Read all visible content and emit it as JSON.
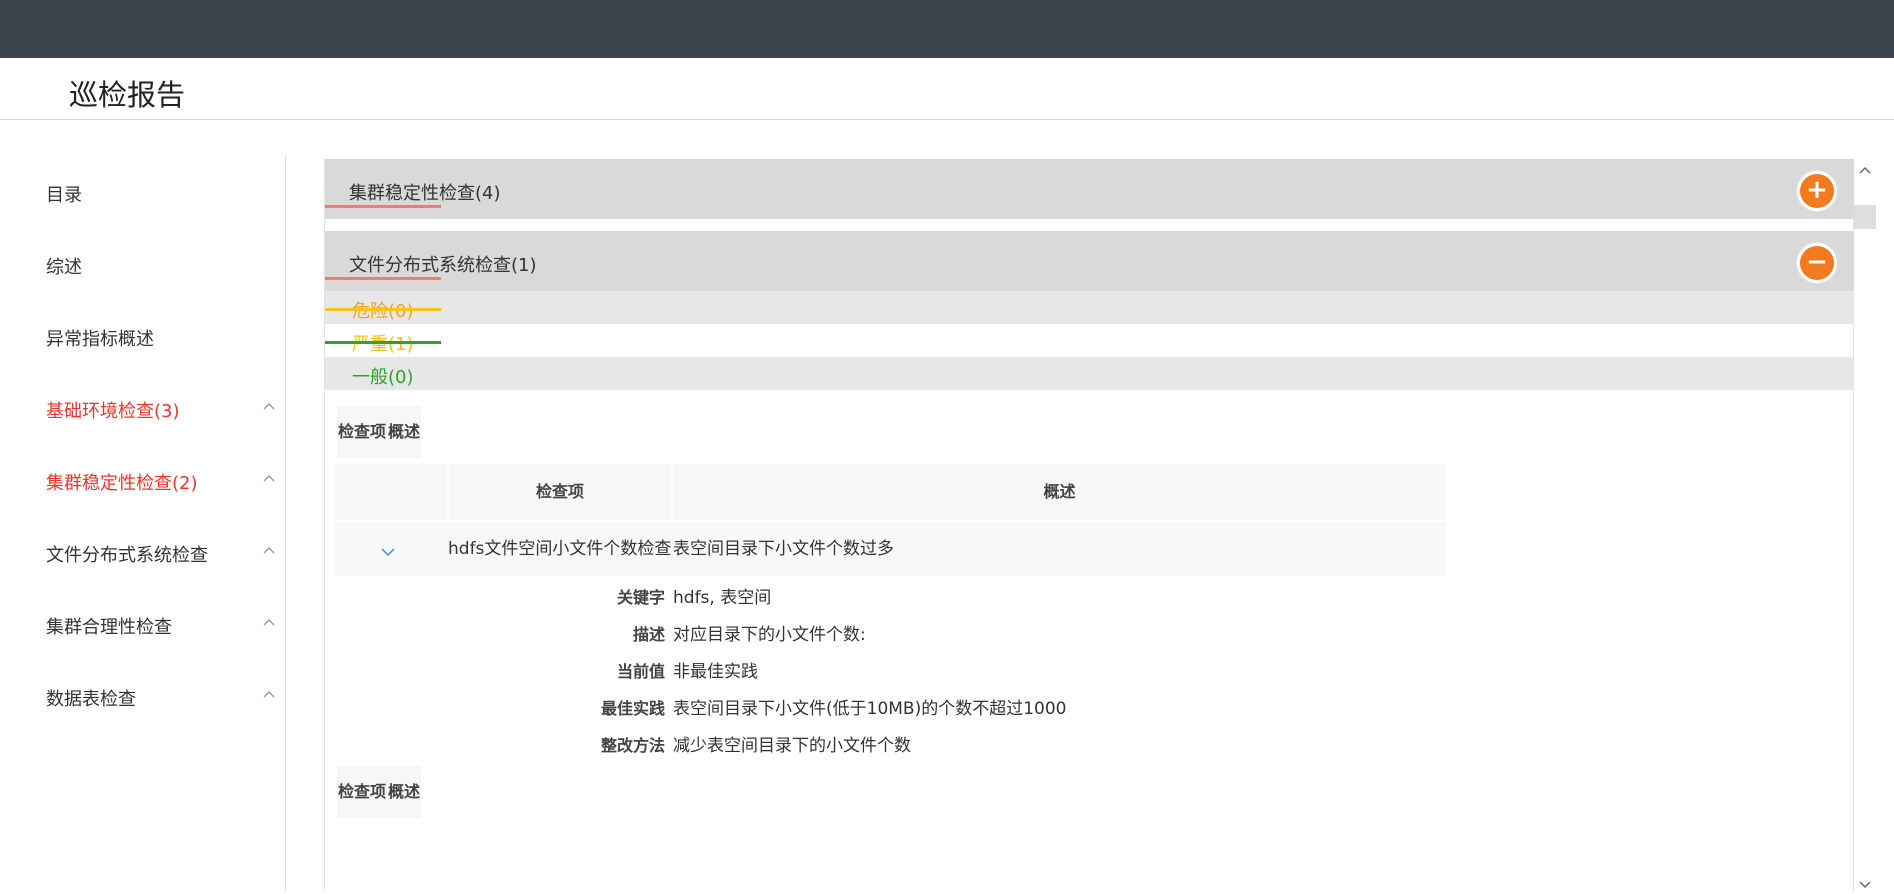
{
  "header": {
    "title": "巡检报告"
  },
  "sidebar": {
    "items": [
      {
        "label": "目录",
        "highlight": false,
        "has_chevron": false
      },
      {
        "label": "综述",
        "highlight": false,
        "has_chevron": false
      },
      {
        "label": "异常指标概述",
        "highlight": false,
        "has_chevron": false
      },
      {
        "label": "基础环境检查(3)",
        "highlight": true,
        "has_chevron": true
      },
      {
        "label": "集群稳定性检查(2)",
        "highlight": true,
        "has_chevron": true
      },
      {
        "label": "文件分布式系统检查",
        "highlight": false,
        "has_chevron": true
      },
      {
        "label": "集群合理性检查",
        "highlight": false,
        "has_chevron": true
      },
      {
        "label": "数据表检查",
        "highlight": false,
        "has_chevron": true
      }
    ]
  },
  "panels": [
    {
      "title": "集群稳定性检查(4)",
      "state": "collapsed",
      "toggle_icon": "plus-icon",
      "toggle_glyph": "+"
    },
    {
      "title": "文件分布式系统检查(1)",
      "state": "expanded",
      "toggle_icon": "minus-icon",
      "toggle_glyph": "−"
    }
  ],
  "severity": [
    {
      "label": "危险(0)",
      "color": "#f4a22a",
      "line_color": "#f5c518"
    },
    {
      "label": "严重(1)",
      "color": "#f2c11a",
      "line_color": "#2aa52a"
    },
    {
      "label": "一般(0)",
      "color": "#2aa52a",
      "line_color": ""
    }
  ],
  "tabs": {
    "item": "检查项",
    "summary": "概述"
  },
  "table": {
    "columns": [
      "",
      "检查项",
      "概述"
    ],
    "rows": [
      {
        "item": "hdfs文件空间小文件个数检查",
        "summary": "表空间目录下小文件个数过多"
      }
    ]
  },
  "detail": [
    {
      "label": "关键字",
      "value": "hdfs, 表空间"
    },
    {
      "label": "描述",
      "value": "对应目录下的小文件个数:"
    },
    {
      "label": "当前值",
      "value": "非最佳实践"
    },
    {
      "label": "最佳实践",
      "value": "表空间目录下小文件(低于10MB)的个数不超过1000"
    },
    {
      "label": "整改方法",
      "value": "减少表空间目录下的小文件个数"
    }
  ],
  "colors": {
    "topbar": "#3d434d",
    "accent_red": "#f0332e",
    "toggle_orange": "#f47a1f",
    "expand_icon": "#3a8ee6"
  }
}
